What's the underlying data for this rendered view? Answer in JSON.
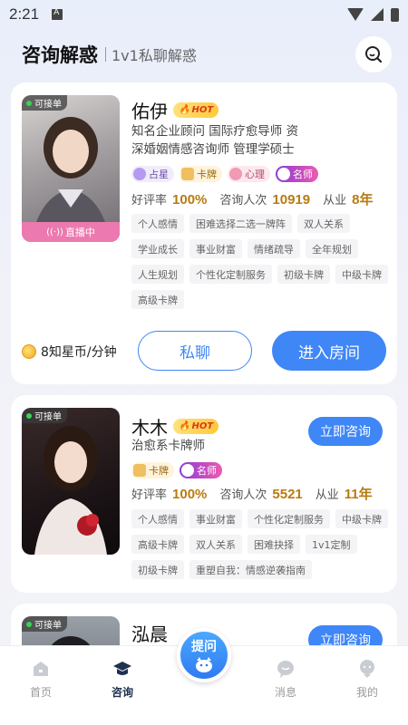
{
  "status_bar": {
    "time": "2:21"
  },
  "header": {
    "title": "咨询解惑",
    "subtitle": "1v1私聊解惑"
  },
  "consultants": [
    {
      "name": "佑伊",
      "hot": "HOT",
      "available": "可接单",
      "live": "直播中",
      "desc": "知名企业顾问 国际疗愈导师 资深婚姻情感咨询师 管理学硕士",
      "skills": [
        "占星",
        "卡牌",
        "心理",
        "名师"
      ],
      "rating_label": "好评率",
      "rating": "100%",
      "count_label": "咨询人次",
      "count": "10919",
      "years_label": "从业",
      "years": "8年",
      "chips": [
        "个人感情",
        "困难选择二选一牌阵",
        "双人关系",
        "学业成长",
        "事业财富",
        "情绪疏导",
        "全年规划",
        "人生规划",
        "个性化定制服务",
        "初级卡牌",
        "中级卡牌",
        "高级卡牌"
      ],
      "price": "8知星币/分钟",
      "chat_label": "私聊",
      "enter_label": "进入房间"
    },
    {
      "name": "木木",
      "hot": "HOT",
      "available": "可接单",
      "desc": "治愈系卡牌师",
      "skills": [
        "卡牌",
        "名师"
      ],
      "rating_label": "好评率",
      "rating": "100%",
      "count_label": "咨询人次",
      "count": "5521",
      "years_label": "从业",
      "years": "11年",
      "chips": [
        "个人感情",
        "事业财富",
        "个性化定制服务",
        "中级卡牌",
        "高级卡牌",
        "双人关系",
        "困难抉择",
        "1v1定制",
        "初级卡牌",
        "重塑自我：情感逆袭指南"
      ],
      "consult_label": "立即咨询"
    },
    {
      "name": "泓晨",
      "available": "可接单",
      "consult_label": "立即咨询"
    }
  ],
  "tabbar": {
    "items": [
      {
        "label": "首页"
      },
      {
        "label": "咨询"
      },
      {
        "label": "提问"
      },
      {
        "label": "消息"
      },
      {
        "label": "我的"
      }
    ]
  },
  "colors": {
    "accent": "#3f86f7",
    "stat_value": "#b97a10",
    "live": "#ec7ab0"
  }
}
